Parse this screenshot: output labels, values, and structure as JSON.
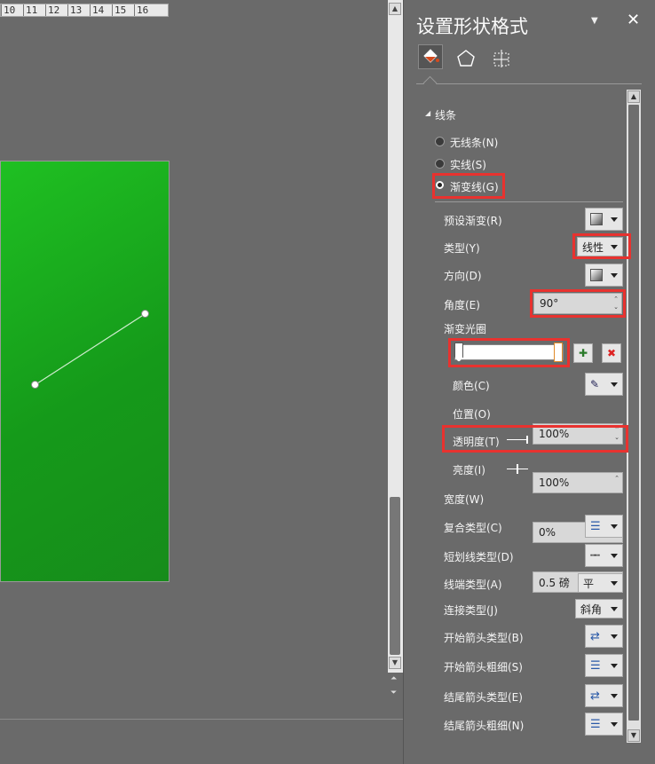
{
  "ruler": {
    "ticks": [
      "10",
      "11",
      "12",
      "13",
      "14",
      "15",
      "16"
    ]
  },
  "pane": {
    "title": "设置形状格式",
    "tabs": [
      "fill-line-icon",
      "pentagon-effects-icon",
      "size-properties-icon"
    ],
    "section": "线条",
    "line_options": [
      {
        "label": "无线条(N)",
        "selected": false
      },
      {
        "label": "实线(S)",
        "selected": false
      },
      {
        "label": "渐变线(G)",
        "selected": true
      }
    ],
    "rows": {
      "preset": {
        "label": "预设渐变(R)"
      },
      "type": {
        "label": "类型(Y)",
        "value": "线性"
      },
      "direction": {
        "label": "方向(D)"
      },
      "angle": {
        "label": "角度(E)",
        "value": "90°"
      },
      "stops": {
        "label": "渐变光圈"
      },
      "color": {
        "label": "颜色(C)"
      },
      "position": {
        "label": "位置(O)",
        "value": "100%"
      },
      "transparency": {
        "label": "透明度(T)",
        "value": "100%"
      },
      "brightness": {
        "label": "亮度(I)",
        "value": "0%"
      },
      "width": {
        "label": "宽度(W)",
        "value": "0.5 磅"
      },
      "compound": {
        "label": "复合类型(C)"
      },
      "dash": {
        "label": "短划线类型(D)"
      },
      "cap": {
        "label": "线端类型(A)",
        "value": "平"
      },
      "join": {
        "label": "连接类型(J)",
        "value": "斜角"
      },
      "begin_arrow_type": {
        "label": "开始箭头类型(B)"
      },
      "begin_arrow_size": {
        "label": "开始箭头粗细(S)"
      },
      "end_arrow_type": {
        "label": "结尾箭头类型(E)"
      },
      "end_arrow_size": {
        "label": "结尾箭头粗细(N)"
      }
    },
    "colors": {
      "highlight": "#e8322f",
      "fill_icon": "#d44a1e",
      "gradient_start": "#1fc022",
      "gradient_end": "#178c1b"
    }
  }
}
